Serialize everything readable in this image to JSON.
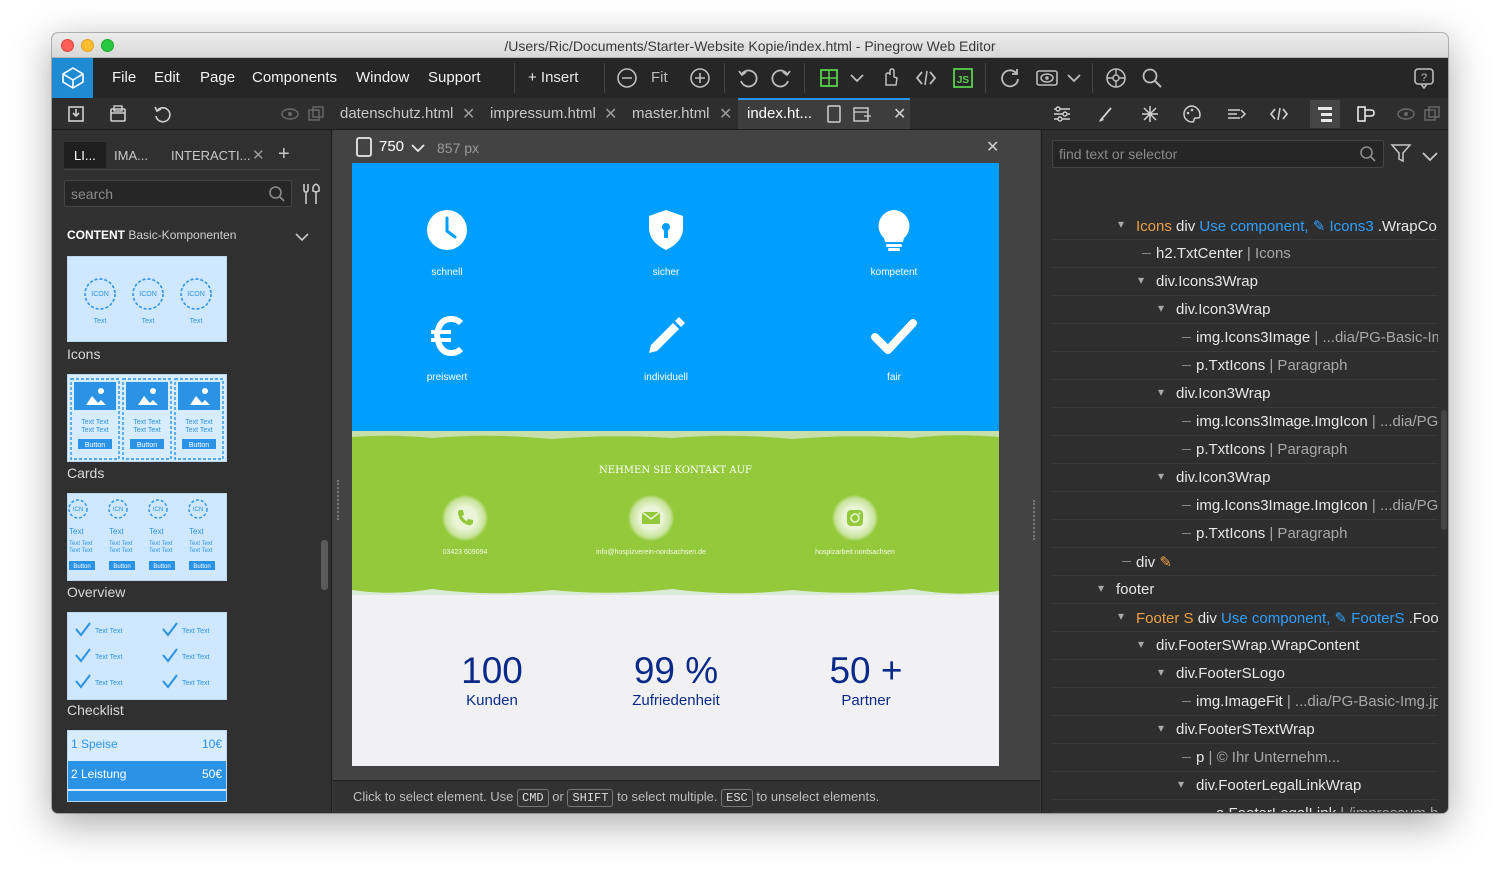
{
  "window": {
    "title": "/Users/Ric/Documents/Starter-Website Kopie/index.html - Pinegrow Web Editor"
  },
  "menu": {
    "items": [
      "File",
      "Edit",
      "Page",
      "Components",
      "Window",
      "Support"
    ],
    "insert_label": "+ Insert",
    "fit_label": "Fit"
  },
  "tabs": [
    {
      "label": "datenschutz.html"
    },
    {
      "label": "impressum.html"
    },
    {
      "label": "master.html"
    },
    {
      "label": "index.ht..."
    }
  ],
  "left_panel": {
    "tabs": [
      "LI...",
      "IMA...",
      "INTERACTI..."
    ],
    "search_placeholder": "search",
    "section_title": "CONTENT",
    "section_subtitle": "Basic-Komponenten",
    "components": [
      {
        "label": "Icons"
      },
      {
        "label": "Cards"
      },
      {
        "label": "Overview"
      },
      {
        "label": "Checklist"
      }
    ],
    "thumb_text": {
      "icon": "ICON",
      "text": "Text",
      "text_text": "Text Text",
      "button": "Button",
      "icn": "ICN"
    },
    "price_list": [
      {
        "name": "1 Speise",
        "price": "10€"
      },
      {
        "name": "2 Leistung",
        "price": "50€"
      }
    ]
  },
  "canvas": {
    "device_width": "750",
    "px_label": "857 px",
    "icons": [
      {
        "icon": "clock-icon",
        "label": "schnell"
      },
      {
        "icon": "shield-icon",
        "label": "sicher"
      },
      {
        "icon": "bulb-icon",
        "label": "kompetent"
      },
      {
        "icon": "euro-icon",
        "label": "preiswert"
      },
      {
        "icon": "pencil-icon",
        "label": "individuell"
      },
      {
        "icon": "check-icon",
        "label": "fair"
      }
    ],
    "contact": {
      "title": "NEHMEN SIE KONTAKT AUF",
      "items": [
        {
          "icon": "phone-icon",
          "text": "03423 609094"
        },
        {
          "icon": "mail-icon",
          "text": "info@hospizverein-nordsachsen.de"
        },
        {
          "icon": "instagram-icon",
          "text": "hospizarbeit.nordsachsen"
        }
      ]
    },
    "stats": [
      {
        "number": "100",
        "label": "Kunden"
      },
      {
        "number": "99 %",
        "label": "Zufriedenheit"
      },
      {
        "number": "50 +",
        "label": "Partner"
      }
    ],
    "colors": {
      "blue": "#009eff",
      "green": "#93c93a",
      "stat_text": "#0a2a8a"
    }
  },
  "status_bar": {
    "part1": "Click to select element. Use",
    "key1": "CMD",
    "part2": "or",
    "key2": "SHIFT",
    "part3": "to select multiple.",
    "key3": "ESC",
    "part4": "to unselect elements."
  },
  "right_panel": {
    "search_placeholder": "find text or selector",
    "tree": [
      {
        "a": "Icons",
        "b": " div",
        "c": "Use component,",
        "d": " ✎ Icons3",
        "e": " .WrapCo"
      },
      {
        "a": "",
        "b": "h2.TxtCenter",
        "f": " | Icons"
      },
      {
        "a": "",
        "b": "div.Icons3Wrap"
      },
      {
        "a": "",
        "b": "div.Icon3Wrap"
      },
      {
        "a": "",
        "b": "img.Icons3Image",
        "f": " | ...dia/PG-Basic-Im"
      },
      {
        "a": "",
        "b": "p.TxtIcons",
        "f": " | Paragraph"
      },
      {
        "a": "",
        "b": "div.Icon3Wrap"
      },
      {
        "a": "",
        "b": "img.Icons3Image.ImgIcon",
        "f": " | ...dia/PG-"
      },
      {
        "a": "",
        "b": "p.TxtIcons",
        "f": " | Paragraph"
      },
      {
        "a": "",
        "b": "div.Icon3Wrap"
      },
      {
        "a": "",
        "b": "img.Icons3Image.ImgIcon",
        "f": " | ...dia/PG-"
      },
      {
        "a": "",
        "b": "p.TxtIcons",
        "f": " | Paragraph"
      },
      {
        "a": "",
        "b": "div"
      },
      {
        "a": "",
        "b": "footer"
      },
      {
        "a": "Footer S",
        "b": " div",
        "c": "Use component,",
        "d": " ✎ FooterS",
        "e": " .Foo"
      },
      {
        "a": "",
        "b": "div.FooterSWrap.WrapContent"
      },
      {
        "a": "",
        "b": "div.FooterSLogo"
      },
      {
        "a": "",
        "b": "img.ImageFit",
        "f": " | ...dia/PG-Basic-Img.jp"
      },
      {
        "a": "",
        "b": "div.FooterSTextWrap"
      },
      {
        "a": "",
        "b": "p",
        "f": " | © Ihr Unternehm..."
      },
      {
        "a": "",
        "b": "div.FooterLegalLinkWrap"
      },
      {
        "a": "",
        "b": "a.FooterLegalLink",
        "f": " | /impressum.ht"
      }
    ]
  }
}
